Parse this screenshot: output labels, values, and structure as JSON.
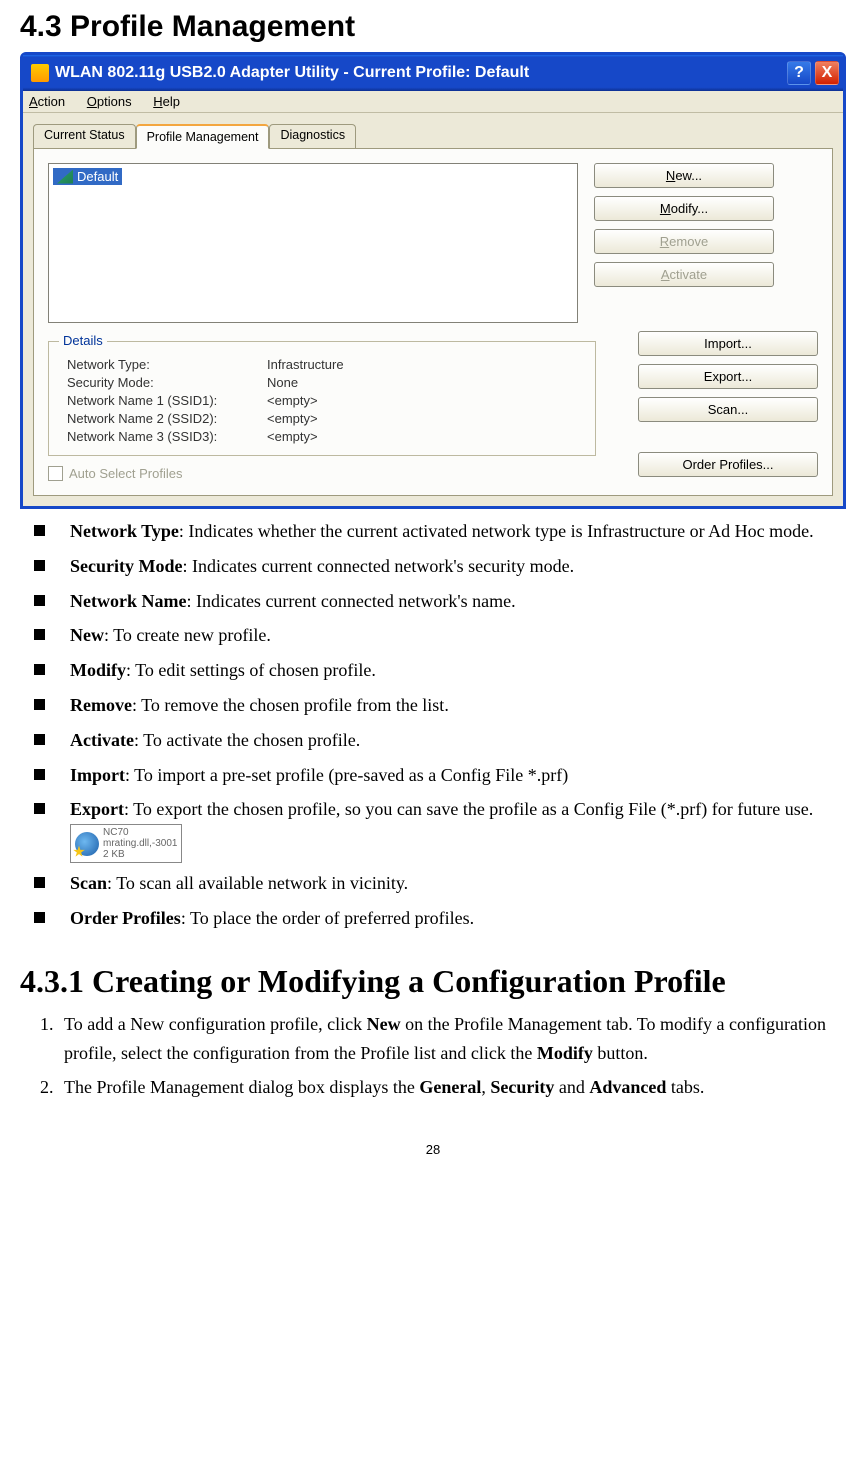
{
  "doc": {
    "heading": "4.3 Profile Management",
    "subheading": "4.3.1 Creating or Modifying a Configuration Profile",
    "page_number": "28"
  },
  "window": {
    "title": "WLAN 802.11g USB2.0 Adapter Utility - Current Profile: Default",
    "help_glyph": "?",
    "close_glyph": "X",
    "menu": {
      "action": "Action",
      "options": "Options",
      "help": "Help"
    },
    "tabs": {
      "status": "Current Status",
      "profile": "Profile Management",
      "diag": "Diagnostics"
    },
    "profile_item": "Default",
    "buttons": {
      "new": "New...",
      "modify": "Modify...",
      "remove": "Remove",
      "activate": "Activate",
      "import": "Import...",
      "export": "Export...",
      "scan": "Scan...",
      "order": "Order Profiles..."
    },
    "details": {
      "title": "Details",
      "rows": {
        "network_type": {
          "label": "Network Type:",
          "value": "Infrastructure"
        },
        "security_mode": {
          "label": "Security Mode:",
          "value": "None"
        },
        "ssid1": {
          "label": "Network Name 1 (SSID1):",
          "value": "<empty>"
        },
        "ssid2": {
          "label": "Network Name 2 (SSID2):",
          "value": "<empty>"
        },
        "ssid3": {
          "label": "Network Name 3 (SSID3):",
          "value": "<empty>"
        }
      }
    },
    "auto_select": "Auto Select Profiles"
  },
  "bullets": {
    "network_type": {
      "term": "Network Type",
      "text": ": Indicates whether the current activated network type is Infrastructure or Ad Hoc mode."
    },
    "security_mode": {
      "term": "Security Mode",
      "text": ": Indicates current connected network's security mode."
    },
    "network_name": {
      "term": "Network Name",
      "text": ": Indicates current connected network's name."
    },
    "new": {
      "term": "New",
      "text": ": To create new profile."
    },
    "modify": {
      "term": "Modify",
      "text": ": To edit settings of chosen profile."
    },
    "remove": {
      "term": "Remove",
      "text": ": To remove the chosen profile from the list."
    },
    "activate": {
      "term": "Activate",
      "text": ": To activate the chosen profile."
    },
    "import": {
      "term": "Import",
      "text": ": To import a pre-set profile (pre-saved as a Config File *.prf)"
    },
    "export": {
      "term": "Export",
      "text_a": ": To export the chosen profile, so you can save the profile as a Config File (*.prf) for future use.  "
    },
    "scan": {
      "term": "Scan",
      "text": ": To scan all available network in vicinity."
    },
    "order": {
      "term": "Order Profiles",
      "text": ": To place the order of preferred profiles."
    }
  },
  "file_preview": {
    "name": "NC70",
    "detail": "mrating.dll,-3001",
    "size": "2 KB"
  },
  "steps": {
    "s1a": "To add a New configuration profile, click ",
    "s1b": "New",
    "s1c": " on the Profile Management tab. To modify a configuration profile, select the configuration from the Profile list and click the ",
    "s1d": "Modify",
    "s1e": " button.",
    "s2a": "The Profile Management dialog box displays the ",
    "s2b": "General",
    "s2c": ", ",
    "s2d": "Security",
    "s2e": " and ",
    "s2f": "Advanced",
    "s2g": " tabs."
  }
}
